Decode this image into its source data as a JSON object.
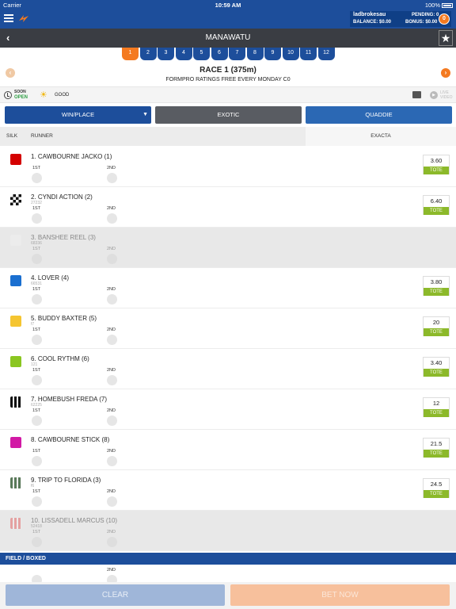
{
  "status_bar": {
    "carrier": "Carrier",
    "time": "10:59 AM",
    "battery": "100%"
  },
  "account": {
    "username": "ladbrokesau",
    "balance": "BALANCE: $0.00",
    "pending": "PENDING: 0",
    "bonus": "BONUS: $0.00",
    "badge": "0"
  },
  "meeting": {
    "title": "MANAWATU"
  },
  "race_tabs": [
    "1",
    "2",
    "3",
    "4",
    "5",
    "6",
    "7",
    "8",
    "9",
    "10",
    "11",
    "12"
  ],
  "active_race": "1",
  "race": {
    "title": "RACE 1 (375m)",
    "subtitle": "FORMPRO RATINGS FREE EVERY MONDAY C0",
    "status_top": "SOON",
    "status_bottom": "OPEN",
    "track": "GOOD",
    "live_video": "LIVE VIDEO"
  },
  "bet_types": {
    "winplace": "WIN/PLACE",
    "exotic": "EXOTIC",
    "quaddie": "QUADDIE"
  },
  "table_header": {
    "silk": "SILK",
    "runner": "RUNNER",
    "exacta": "EXACTA"
  },
  "position_labels": {
    "first": "1ST",
    "second": "2ND"
  },
  "runners": [
    {
      "name": "1. CAWBOURNE JACKO (1)",
      "form": "",
      "odds": "3.60",
      "tote": "TOTE",
      "silk_color": "#d40000",
      "scratched": false
    },
    {
      "name": "2. CYNDI ACTION (2)",
      "form": "27232",
      "odds": "6.40",
      "tote": "TOTE",
      "silk_color": "checker",
      "scratched": false
    },
    {
      "name": "3. BANSHEE REEL (3)",
      "form": "68336",
      "odds": "",
      "tote": "",
      "silk_color": "#f0f0f0",
      "scratched": true
    },
    {
      "name": "4. LOVER (4)",
      "form": "66531",
      "odds": "3.80",
      "tote": "TOTE",
      "silk_color": "#1a6fd0",
      "scratched": false
    },
    {
      "name": "5. BUDDY BAXTER (5)",
      "form": "f7",
      "odds": "20",
      "tote": "TOTE",
      "silk_color": "#f5c531",
      "scratched": false
    },
    {
      "name": "6. COOL RYTHM (6)",
      "form": "121",
      "odds": "3.40",
      "tote": "TOTE",
      "silk_color": "#8ac621",
      "scratched": false
    },
    {
      "name": "7. HOMEBUSH FREDA (7)",
      "form": "62225",
      "odds": "12",
      "tote": "TOTE",
      "silk_color": "stripe-bw",
      "scratched": false
    },
    {
      "name": "8. CAWBOURNE STICK (8)",
      "form": "",
      "odds": "21.5",
      "tote": "TOTE",
      "silk_color": "#d21aa5",
      "scratched": false
    },
    {
      "name": "9. TRIP TO FLORIDA (3)",
      "form": "f6",
      "odds": "24.5",
      "tote": "TOTE",
      "silk_color": "stripe-gw",
      "scratched": false
    },
    {
      "name": "10. LISSADELL MARCUS (10)",
      "form": "52418",
      "odds": "",
      "tote": "",
      "silk_color": "stripe-rw",
      "scratched": true
    }
  ],
  "field_boxed": {
    "label": "FIELD / BOXED"
  },
  "actions": {
    "clear": "CLEAR",
    "bet_now": "BET NOW"
  }
}
